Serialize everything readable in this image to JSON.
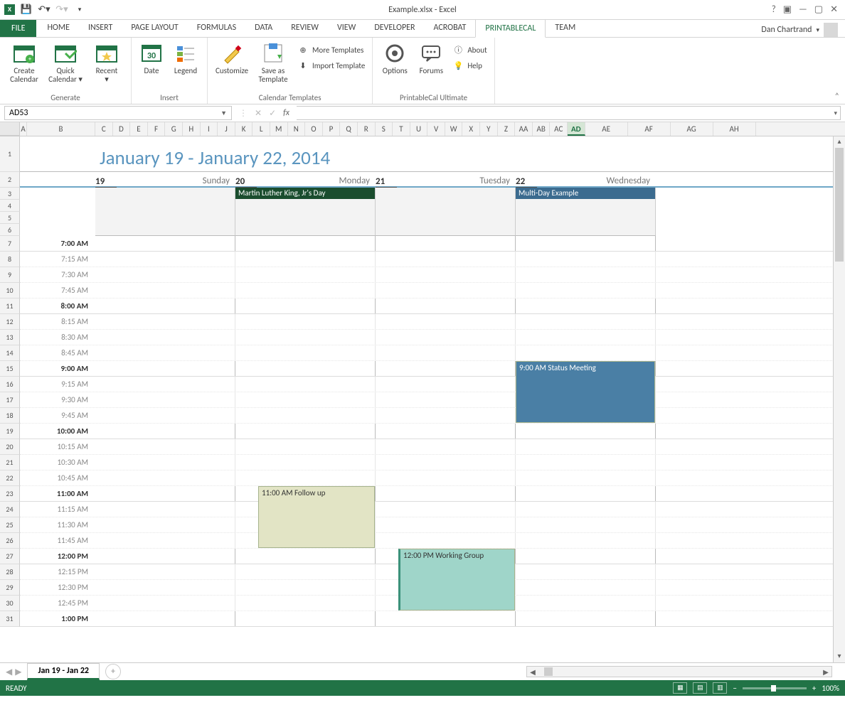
{
  "app": {
    "title": "Example.xlsx - Excel",
    "user": "Dan Chartrand"
  },
  "qat": {
    "save": "💾",
    "undo": "↶",
    "redo": "↷"
  },
  "tabs": [
    "HOME",
    "INSERT",
    "PAGE LAYOUT",
    "FORMULAS",
    "DATA",
    "REVIEW",
    "VIEW",
    "DEVELOPER",
    "ACROBAT",
    "PRINTABLECAL",
    "TEAM"
  ],
  "active_tab": "PRINTABLECAL",
  "file_tab": "FILE",
  "ribbon": {
    "groups": [
      {
        "label": "Generate",
        "big": [
          {
            "k": "create",
            "l": "Create\nCalendar"
          },
          {
            "k": "quick",
            "l": "Quick\nCalendar"
          },
          {
            "k": "recent",
            "l": "Recent"
          }
        ]
      },
      {
        "label": "Insert",
        "big": [
          {
            "k": "date",
            "l": "Date"
          },
          {
            "k": "legend",
            "l": "Legend"
          }
        ]
      },
      {
        "label": "Calendar Templates",
        "big": [
          {
            "k": "custom",
            "l": "Customize"
          },
          {
            "k": "saveas",
            "l": "Save as\nTemplate"
          }
        ],
        "small": [
          {
            "k": "more",
            "l": "More Templates"
          },
          {
            "k": "import",
            "l": "Import Template"
          }
        ]
      },
      {
        "label": "PrintableCal Ultimate",
        "big": [
          {
            "k": "options",
            "l": "Options"
          },
          {
            "k": "forums",
            "l": "Forums"
          }
        ],
        "small": [
          {
            "k": "about",
            "l": "About"
          },
          {
            "k": "help",
            "l": "Help"
          }
        ]
      }
    ]
  },
  "namebox": "AD53",
  "columns": [
    "A",
    "B",
    "C",
    "D",
    "E",
    "F",
    "G",
    "H",
    "I",
    "J",
    "K",
    "L",
    "M",
    "N",
    "O",
    "P",
    "Q",
    "R",
    "S",
    "T",
    "U",
    "V",
    "W",
    "X",
    "Y",
    "Z",
    "AA",
    "AB",
    "AC",
    "AD",
    "AE",
    "AF",
    "AG",
    "AH"
  ],
  "colB_w": 106,
  "narrow_w": 24.6,
  "calendar": {
    "title": "January 19 - January 22, 2014",
    "days": [
      {
        "num": "19",
        "name": "Sunday"
      },
      {
        "num": "20",
        "name": "Monday"
      },
      {
        "num": "21",
        "name": "Tuesday"
      },
      {
        "num": "22",
        "name": "Wednesday"
      }
    ],
    "allday": [
      {
        "day": 1,
        "text": "Martin Luther King, Jr's Day",
        "bg": "#1a4d2e"
      },
      {
        "day": 3,
        "text": "Multi-Day Example",
        "bg": "#3b6b8f",
        "wide": true
      }
    ],
    "times": [
      "7:00 AM",
      "7:15 AM",
      "7:30 AM",
      "7:45 AM",
      "8:00 AM",
      "8:15 AM",
      "8:30 AM",
      "8:45 AM",
      "9:00 AM",
      "9:15 AM",
      "9:30 AM",
      "9:45 AM",
      "10:00 AM",
      "10:15 AM",
      "10:30 AM",
      "10:45 AM",
      "11:00 AM",
      "11:15 AM",
      "11:30 AM",
      "11:45 AM",
      "12:00 PM",
      "12:15 PM",
      "12:30 PM",
      "12:45 PM",
      "1:00 PM"
    ],
    "events": [
      {
        "day": 3,
        "row": 8,
        "span": 4,
        "text": "9:00 AM  Status Meeting",
        "cls": "evblue"
      },
      {
        "day": 1,
        "row": 16,
        "span": 4,
        "text": "11:00 AM  Follow up",
        "cls": "evmo",
        "pad": 32
      },
      {
        "day": 2,
        "row": 20,
        "span": 4,
        "text": "12:00 PM  Working Group",
        "cls": "evtu",
        "pad": 32
      }
    ]
  },
  "rownums_top": [
    1,
    2
  ],
  "rownums_allday": [
    3,
    4,
    5,
    6
  ],
  "rownums_start": 7,
  "sheet": {
    "name": "Jan 19 - Jan 22"
  },
  "status": {
    "ready": "READY",
    "zoom": "100%"
  }
}
